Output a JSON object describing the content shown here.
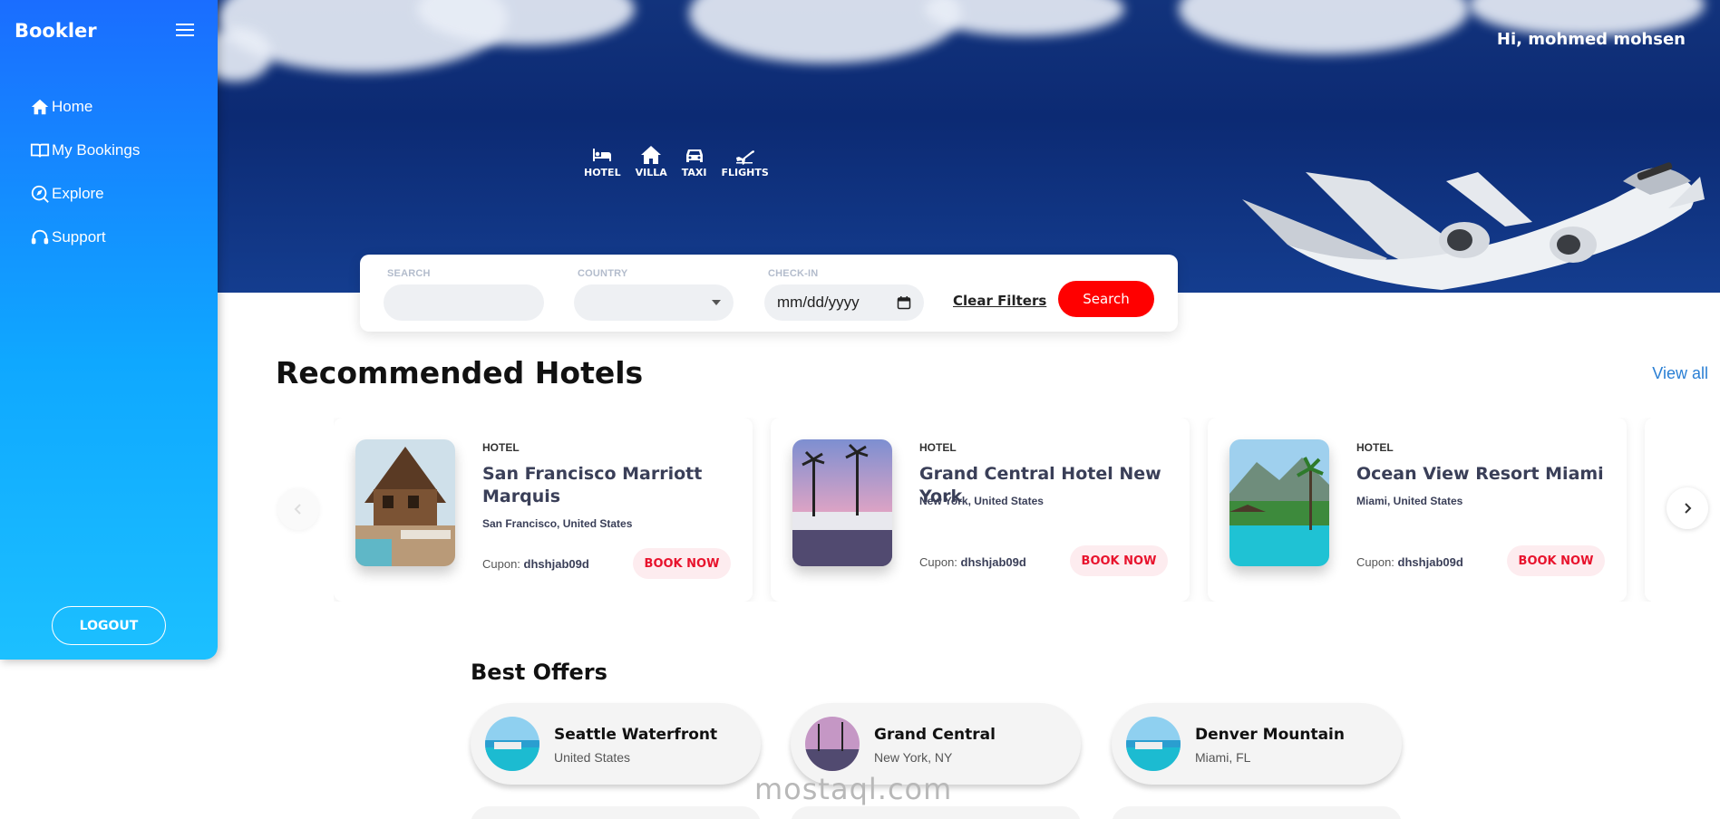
{
  "sidebar": {
    "brand": "Bookler",
    "items": [
      {
        "label": "Home",
        "icon": "home-icon"
      },
      {
        "label": "My Bookings",
        "icon": "book-icon"
      },
      {
        "label": "Explore",
        "icon": "explore-icon"
      },
      {
        "label": "Support",
        "icon": "headset-icon"
      }
    ],
    "logout_label": "LOGOUT"
  },
  "header": {
    "greeting": "Hi, mohmed mohsen",
    "categories": [
      {
        "label": "HOTEL",
        "icon": "bed-icon"
      },
      {
        "label": "VILLA",
        "icon": "house-icon"
      },
      {
        "label": "TAXI",
        "icon": "car-icon"
      },
      {
        "label": "FLIGHTS",
        "icon": "plane-icon"
      }
    ]
  },
  "search": {
    "search_label": "SEARCH",
    "search_value": "",
    "country_label": "COUNTRY",
    "country_value": "",
    "checkin_label": "CHECK-IN",
    "checkin_placeholder": "mm/dd/yyyy",
    "clear_label": "Clear Filters",
    "search_button": "Search"
  },
  "recommended": {
    "title": "Recommended Hotels",
    "view_all": "View all",
    "hotels": [
      {
        "type": "HOTEL",
        "name": "San Francisco Marriott Marquis",
        "location": "San Francisco, United States",
        "coupon_label": "Cupon:",
        "coupon": "dhshjab09d",
        "book_label": "BOOK NOW"
      },
      {
        "type": "HOTEL",
        "name": "Grand Central Hotel New York",
        "location": "New York, United States",
        "coupon_label": "Cupon:",
        "coupon": "dhshjab09d",
        "book_label": "BOOK NOW"
      },
      {
        "type": "HOTEL",
        "name": "Ocean View Resort Miami",
        "location": "Miami, United States",
        "coupon_label": "Cupon:",
        "coupon": "dhshjab09d",
        "book_label": "BOOK NOW"
      }
    ]
  },
  "offers": {
    "title": "Best Offers",
    "items": [
      {
        "name": "Seattle Waterfront",
        "location": "United States"
      },
      {
        "name": "Grand Central",
        "location": "New York, NY"
      },
      {
        "name": "Denver Mountain",
        "location": "Miami, FL"
      }
    ]
  },
  "watermark": "mostaql.com",
  "colors": {
    "sidebar_top": "#1a6dff",
    "sidebar_bottom": "#1cc0ff",
    "accent_red": "#ff0000",
    "link_blue": "#2a7fd4"
  }
}
